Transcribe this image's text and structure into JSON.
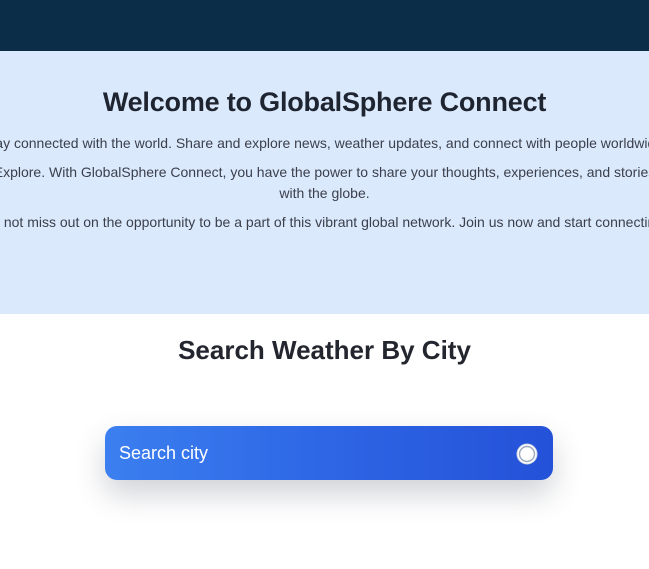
{
  "hero": {
    "title": "Welcome to GlobalSphere Connect",
    "paragraph_1": "Stay connected with the world. Share and explore news, weather updates, and connect with people worldwide.",
    "paragraph_2": "Explore. With GlobalSphere Connect, you have the power to share your thoughts, experiences, and stories with the globe.",
    "paragraph_3": "Do not miss out on the opportunity to be a part of this vibrant global network. Join us now and start connecting."
  },
  "search": {
    "title": "Search Weather By City",
    "placeholder": "Search city",
    "icon": "search-icon"
  },
  "colors": {
    "topbar": "#0b2d48",
    "hero_background": "#dbe9fd",
    "search_gradient_start": "#3b7ff0",
    "search_gradient_end": "#2451d8"
  }
}
